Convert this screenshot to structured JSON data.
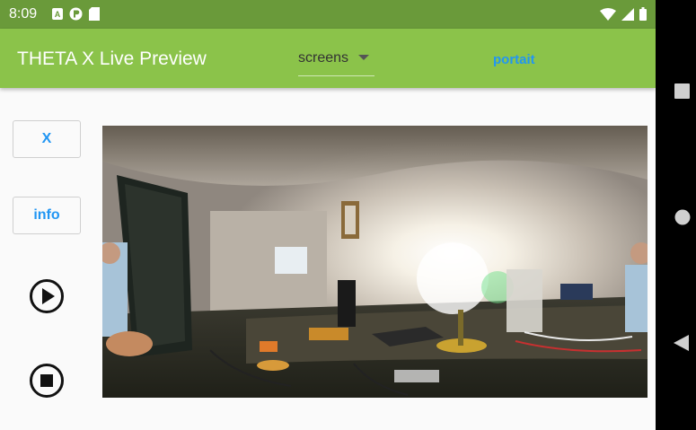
{
  "status_bar": {
    "time": "8:09",
    "left_icons": [
      "a-icon",
      "p-icon",
      "sd-card-icon"
    ],
    "right_icons": [
      "wifi-icon",
      "signal-icon",
      "battery-icon"
    ]
  },
  "app_bar": {
    "title": "THETA X Live Preview",
    "dropdown_value": "screens",
    "portrait_label": "portait",
    "background": "#8bc34a"
  },
  "side_buttons": {
    "x_label": "X",
    "info_label": "info"
  },
  "controls": {
    "play_icon": "play-circle-icon",
    "stop_icon": "stop-circle-icon"
  },
  "nav_bar": {
    "icons": [
      "recents-icon",
      "home-icon",
      "back-icon"
    ]
  },
  "preview": {
    "content": "360-degree-live-preview-image"
  }
}
